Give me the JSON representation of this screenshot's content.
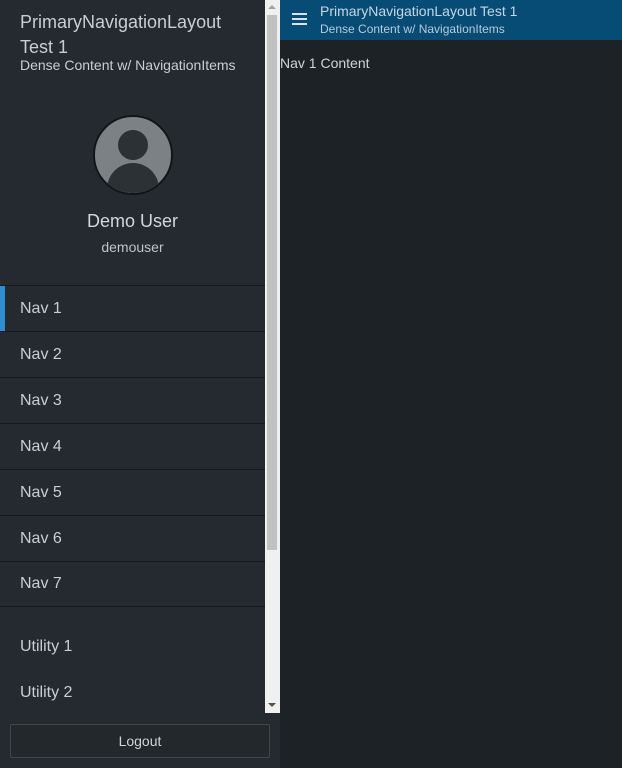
{
  "sidebar": {
    "title": "PrimaryNavigationLayout Test 1",
    "subtitle": "Dense Content w/ NavigationItems",
    "user": {
      "name": "Demo User",
      "handle": "demouser"
    },
    "nav_items": [
      {
        "label": "Nav 1",
        "active": true
      },
      {
        "label": "Nav 2"
      },
      {
        "label": "Nav 3"
      },
      {
        "label": "Nav 4"
      },
      {
        "label": "Nav 5"
      },
      {
        "label": "Nav 6"
      },
      {
        "label": "Nav 7"
      }
    ],
    "utility_items": [
      {
        "label": "Utility 1"
      },
      {
        "label": "Utility 2"
      }
    ],
    "logout_label": "Logout"
  },
  "header": {
    "title": "PrimaryNavigationLayout Test 1",
    "subtitle": "Dense Content w/ NavigationItems",
    "menu_icon": "hamburger-menu-icon"
  },
  "main": {
    "content": "Nav 1 Content"
  },
  "colors": {
    "accent": "#2f8fd3",
    "topbar": "#074c75",
    "sidebar": "#242a2f",
    "background": "#1c2226"
  }
}
